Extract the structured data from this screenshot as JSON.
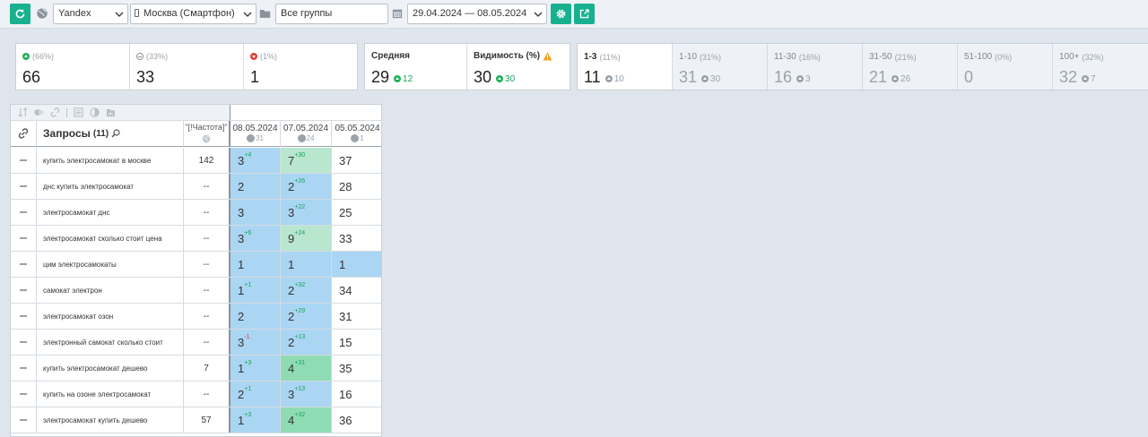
{
  "toolbar": {
    "search_engine": "Yandex",
    "region": "Москва (Смартфон)",
    "group": "Все группы",
    "date_range": "29.04.2024 — 08.05.2024"
  },
  "summary": [
    {
      "icon": "up",
      "pct": "(66%)",
      "value": "66"
    },
    {
      "icon": "neutral",
      "pct": "(33%)",
      "value": "33"
    },
    {
      "icon": "down",
      "pct": "(1%)",
      "value": "1"
    }
  ],
  "average": {
    "label": "Средняя",
    "value": "29",
    "delta": "12"
  },
  "visibility": {
    "label": "Видимость (%)",
    "value": "30",
    "delta": "30"
  },
  "ranges": [
    {
      "label": "1-3",
      "pct": "(11%)",
      "value": "11",
      "delta": "10",
      "dim": false
    },
    {
      "label": "1-10",
      "pct": "(31%)",
      "value": "31",
      "delta": "30",
      "dim": true
    },
    {
      "label": "11-30",
      "pct": "(16%)",
      "value": "16",
      "delta": "3",
      "dim": true
    },
    {
      "label": "31-50",
      "pct": "(21%)",
      "value": "21",
      "delta": "26",
      "dim": true
    },
    {
      "label": "51-100",
      "pct": "(0%)",
      "value": "0",
      "delta": "",
      "dim": true
    },
    {
      "label": "100+",
      "pct": "(32%)",
      "value": "32",
      "delta": "7",
      "dim": true
    }
  ],
  "table": {
    "query_header": "Запросы",
    "query_count": "(11)",
    "freq_header": "\"[!Частота]\"",
    "dates": [
      {
        "date": "08.05.2024",
        "count": "31"
      },
      {
        "date": "07.05.2024",
        "count": "24"
      },
      {
        "date": "05.05.2024",
        "count": "1"
      }
    ],
    "rows": [
      {
        "query": "купить электросамокат в москве",
        "freq": "142",
        "p": [
          {
            "v": "3",
            "d": "+4",
            "c": "b1"
          },
          {
            "v": "7",
            "d": "+30",
            "c": "b2"
          },
          {
            "v": "37",
            "d": "",
            "c": "bw"
          }
        ]
      },
      {
        "query": "днс купить электросамокат",
        "freq": "--",
        "p": [
          {
            "v": "2",
            "d": "",
            "c": "b1"
          },
          {
            "v": "2",
            "d": "+26",
            "c": "b1"
          },
          {
            "v": "28",
            "d": "",
            "c": "bw"
          }
        ]
      },
      {
        "query": "электросамокат днс",
        "freq": "--",
        "p": [
          {
            "v": "3",
            "d": "",
            "c": "b1"
          },
          {
            "v": "3",
            "d": "+22",
            "c": "b1"
          },
          {
            "v": "25",
            "d": "",
            "c": "bw"
          }
        ]
      },
      {
        "query": "электросамокат сколько стоит цена",
        "freq": "--",
        "p": [
          {
            "v": "3",
            "d": "+6",
            "c": "b1"
          },
          {
            "v": "9",
            "d": "+24",
            "c": "b2"
          },
          {
            "v": "33",
            "d": "",
            "c": "bw"
          }
        ]
      },
      {
        "query": "цим электросамокаты",
        "freq": "--",
        "p": [
          {
            "v": "1",
            "d": "",
            "c": "b1"
          },
          {
            "v": "1",
            "d": "",
            "c": "b1"
          },
          {
            "v": "1",
            "d": "",
            "c": "b1"
          }
        ]
      },
      {
        "query": "самокат электрон",
        "freq": "--",
        "p": [
          {
            "v": "1",
            "d": "+1",
            "c": "b1"
          },
          {
            "v": "2",
            "d": "+32",
            "c": "b1"
          },
          {
            "v": "34",
            "d": "",
            "c": "bw"
          }
        ]
      },
      {
        "query": "электросамокат озон",
        "freq": "--",
        "p": [
          {
            "v": "2",
            "d": "",
            "c": "b1"
          },
          {
            "v": "2",
            "d": "+29",
            "c": "b1"
          },
          {
            "v": "31",
            "d": "",
            "c": "bw"
          }
        ]
      },
      {
        "query": "электронный самокат сколько стоит",
        "freq": "--",
        "p": [
          {
            "v": "3",
            "d": "-1",
            "c": "b1"
          },
          {
            "v": "2",
            "d": "+13",
            "c": "b1"
          },
          {
            "v": "15",
            "d": "",
            "c": "bw"
          }
        ]
      },
      {
        "query": "купить электросамокат дешево",
        "freq": "7",
        "p": [
          {
            "v": "1",
            "d": "+3",
            "c": "b1"
          },
          {
            "v": "4",
            "d": "+31",
            "c": "b3"
          },
          {
            "v": "35",
            "d": "",
            "c": "bw"
          }
        ]
      },
      {
        "query": "купить на озоне электросамокат",
        "freq": "--",
        "p": [
          {
            "v": "2",
            "d": "+1",
            "c": "b1"
          },
          {
            "v": "3",
            "d": "+13",
            "c": "b1"
          },
          {
            "v": "16",
            "d": "",
            "c": "bw"
          }
        ]
      },
      {
        "query": "электросамокат купить дешево",
        "freq": "57",
        "p": [
          {
            "v": "1",
            "d": "+3",
            "c": "b1"
          },
          {
            "v": "4",
            "d": "+32",
            "c": "b3"
          },
          {
            "v": "36",
            "d": "",
            "c": "bw"
          }
        ]
      }
    ]
  }
}
